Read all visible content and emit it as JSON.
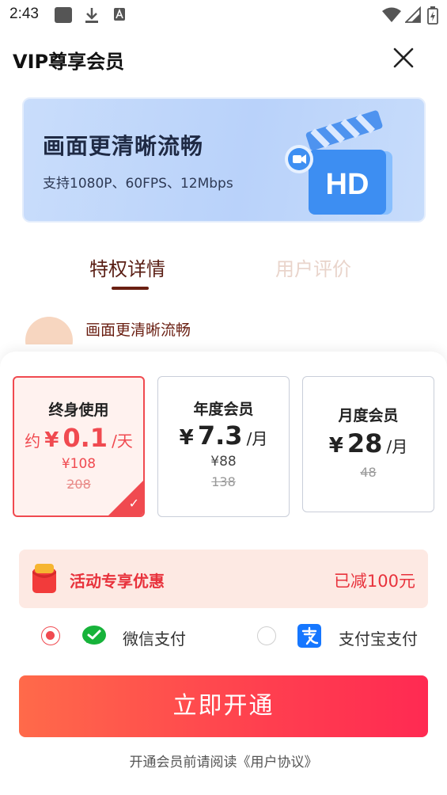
{
  "status_bar": {
    "time": "2:43"
  },
  "header": {
    "title": "VIP尊享会员"
  },
  "banner": {
    "title": "画面更清晰流畅",
    "subtitle": "支持1080P、60FPS、12Mbps",
    "badge": "HD"
  },
  "tabs": [
    {
      "label": "特权详情",
      "active": true
    },
    {
      "label": "用户评价",
      "active": false
    }
  ],
  "feature_peek": {
    "label": "画面更清晰流畅"
  },
  "plans": [
    {
      "name": "终身使用",
      "prefix": "约",
      "currency": "¥",
      "price": "0.1",
      "unit": "/天",
      "sub_price": "¥108",
      "original": "208",
      "selected": true
    },
    {
      "name": "年度会员",
      "prefix": "",
      "currency": "¥",
      "price": "7.3",
      "unit": "/月",
      "sub_price": "¥88",
      "original": "138",
      "selected": false
    },
    {
      "name": "月度会员",
      "prefix": "",
      "currency": "¥",
      "price": "28",
      "unit": "/月",
      "sub_price": "",
      "original": "48",
      "selected": false
    }
  ],
  "promo": {
    "label": "活动专享优惠",
    "value": "已减100元"
  },
  "payment": {
    "wechat": {
      "label": "微信支付",
      "selected": true
    },
    "alipay": {
      "label": "支付宝支付",
      "selected": false
    }
  },
  "cta": {
    "label": "立即开通"
  },
  "agreement": {
    "text": "开通会员前请阅读《用户协议》"
  },
  "colors": {
    "accent": "#f04a50",
    "tab_active": "#5a1e14",
    "banner_bg": "#bfd6fa"
  }
}
